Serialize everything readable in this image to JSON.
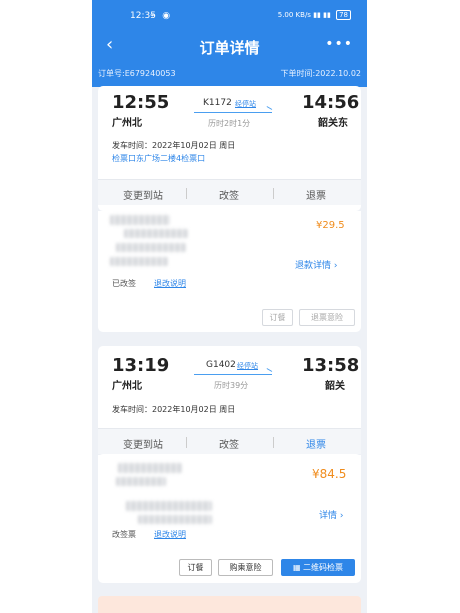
{
  "status_bar": {
    "time": "12:35",
    "signal_text": "5.00 KB/s",
    "battery": "78"
  },
  "header": {
    "title": "订单详情",
    "back_glyph": "‹",
    "more_glyph": "•••"
  },
  "order": {
    "number": "订单号:E679240053",
    "time": "下单时间:2022.10.02"
  },
  "trip1": {
    "depart_time": "12:55",
    "depart_station": "广州北",
    "train": "K1172",
    "via_label": "经停站",
    "duration": "历时2时1分",
    "arrive_time": "14:56",
    "arrive_station": "韶关东",
    "depart_date": "发车时间：2022年10月02日 周日",
    "gate": "检票口东广场二楼4检票口",
    "actions": [
      "变更到站",
      "改签",
      "退票"
    ],
    "price": "¥29.5",
    "refund_link": "退款详情 ›",
    "ticket_status": "已改签",
    "policy_link": "退改说明",
    "buttons": [
      "订餐",
      "退票意险"
    ]
  },
  "trip2": {
    "depart_time": "13:19",
    "depart_station": "广州北",
    "train": "G1402",
    "via_label": "经停站",
    "duration": "历时39分",
    "arrive_time": "13:58",
    "arrive_station": "韶关",
    "depart_date": "发车时间：2022年10月02日 周日",
    "actions": [
      "变更到站",
      "改签",
      "退票"
    ],
    "price": "¥84.5",
    "detail_link": "详情 ›",
    "ticket_status": "改签票",
    "policy_link": "退改说明",
    "buttons": [
      "订餐",
      "购乘意险",
      "二维码检票"
    ]
  },
  "colors": {
    "brand": "#2e86e8",
    "price": "#f08c1c",
    "background": "#eef1f6"
  }
}
